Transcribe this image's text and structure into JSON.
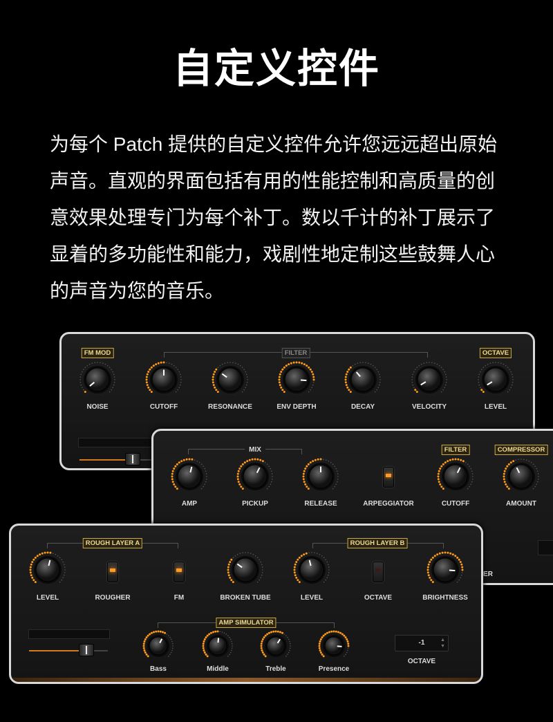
{
  "title": "自定义控件",
  "description": "为每个 Patch 提供的自定义控件允许您远远超出原始声音。直观的界面包括有用的性能控制和高质量的创意效果处理专门为每个补丁。数以千计的补丁展示了显着的多功能性和能力，戏剧性地定制这些鼓舞人心的声音为您的音乐。",
  "colors": {
    "accent": "#ff9a2a",
    "tag": "#f0d890",
    "background": "#000000"
  },
  "panel1": {
    "tags": {
      "fm_mod": "FM MOD",
      "filter": "FILTER",
      "octave": "OCTAVE"
    },
    "knobs": [
      {
        "label": "NOISE",
        "value": 0.02
      },
      {
        "label": "CUTOFF",
        "value": 0.5
      },
      {
        "label": "RESONANCE",
        "value": 0.3
      },
      {
        "label": "ENV DEPTH",
        "value": 0.85
      },
      {
        "label": "DECAY",
        "value": 0.35
      },
      {
        "label": "VELOCITY",
        "value": 0.05
      },
      {
        "label": "LEVEL",
        "value": 0.05
      }
    ],
    "slider_value": 0.68
  },
  "panel2": {
    "tags": {
      "mix": "MIX",
      "filter": "FILTER",
      "compressor": "COMPRESSOR"
    },
    "knobs": [
      {
        "label": "AMP",
        "value": 0.55
      },
      {
        "label": "PICKUP",
        "value": 0.6
      },
      {
        "label": "RELEASE",
        "value": 0.5
      },
      {
        "label": "CUTOFF",
        "value": 0.6
      },
      {
        "label": "AMOUNT",
        "value": 0.4
      }
    ],
    "switch": {
      "label": "ARPEGGIATOR",
      "on": true
    },
    "partial_label": "ER"
  },
  "panel3": {
    "tags": {
      "rough_a": "ROUGH LAYER A",
      "rough_b": "ROUGH LAYER B",
      "amp_sim": "AMP SIMULATOR"
    },
    "knobs": [
      {
        "label": "LEVEL",
        "value": 0.55
      },
      {
        "label": "BROKEN TUBE",
        "value": 0.3
      },
      {
        "label": "LEVEL",
        "value": 0.45
      },
      {
        "label": "BRIGHTNESS",
        "value": 0.85
      }
    ],
    "switches": [
      {
        "label": "ROUGHER",
        "on": true
      },
      {
        "label": "FM",
        "on": true
      },
      {
        "label": "OCTAVE",
        "on": false
      }
    ],
    "amp_knobs": [
      {
        "label": "Bass",
        "value": 0.6
      },
      {
        "label": "Middle",
        "value": 0.52
      },
      {
        "label": "Treble",
        "value": 0.62
      },
      {
        "label": "Presence",
        "value": 0.85
      }
    ],
    "octave": {
      "value": "-1",
      "label": "OCTAVE"
    },
    "slider_value": 0.68
  }
}
